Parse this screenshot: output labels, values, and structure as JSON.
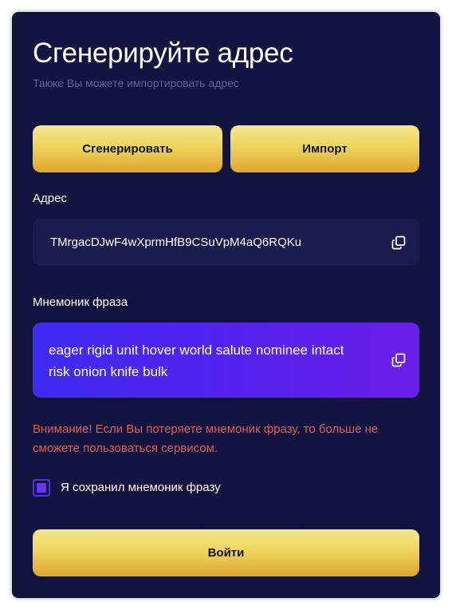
{
  "header": {
    "title": "Сгенерируйте адрес",
    "subtitle": "Также Вы можете импортировать адрес"
  },
  "actions": {
    "generate_label": "Сгенерировать",
    "import_label": "Импорт"
  },
  "address": {
    "label": "Адрес",
    "value": "TMrgacDJwF4wXprmHfB9CSuVpM4aQ6RQKu",
    "copy_icon": "copy-icon"
  },
  "mnemonic": {
    "label": "Мнемоник фраза",
    "value": "eager rigid unit hover world salute nominee intact risk onion knife bulk",
    "copy_icon": "copy-icon"
  },
  "warning": "Внимание! Если Вы потеряете мнемоник фразу, то больше не сможете пользоваться сервисом.",
  "confirm": {
    "label": "Я сохранил мнемоник фразу",
    "checked": true
  },
  "submit_label": "Войти",
  "colors": {
    "background": "#12133f",
    "button_gradient": [
      "#f3e88f",
      "#dca52e"
    ],
    "mnemonic_gradient": [
      "#3f2bf2",
      "#6b1fe8"
    ],
    "warning": "#e25a57",
    "subtitle": "#5f6490"
  }
}
